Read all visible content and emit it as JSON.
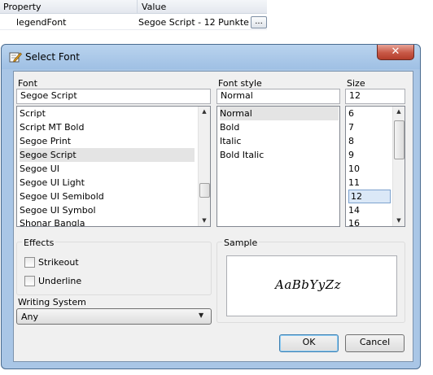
{
  "property_grid": {
    "header_property": "Property",
    "header_value": "Value",
    "row_name": "legendFont",
    "row_value": "Segoe Script - 12 Punkte",
    "ellipsis": "..."
  },
  "dialog": {
    "title": "Select Font",
    "close_glyph": "✕",
    "font_label": "Font",
    "font_value": "Segoe Script",
    "font_list": [
      "Script",
      "Script MT Bold",
      "Segoe Print",
      "Segoe Script",
      "Segoe UI",
      "Segoe UI Light",
      "Segoe UI Semibold",
      "Segoe UI Symbol",
      "Shonar Bangla"
    ],
    "style_label": "Font style",
    "style_value": "Normal",
    "style_list": [
      "Normal",
      "Bold",
      "Italic",
      "Bold Italic"
    ],
    "size_label": "Size",
    "size_value": "12",
    "size_list": [
      "6",
      "7",
      "8",
      "9",
      "10",
      "11",
      "12",
      "14",
      "16"
    ],
    "effects_label": "Effects",
    "strikeout_label": "Strikeout",
    "underline_label": "Underline",
    "sample_label": "Sample",
    "sample_text": "AaBbYyZz",
    "writing_system_label": "Writing System",
    "writing_system_value": "Any",
    "ok_label": "OK",
    "cancel_label": "Cancel"
  },
  "colors": {
    "selection": "#dbe8f7",
    "title_bar": "#a9c6e6",
    "close_button": "#c75846"
  }
}
